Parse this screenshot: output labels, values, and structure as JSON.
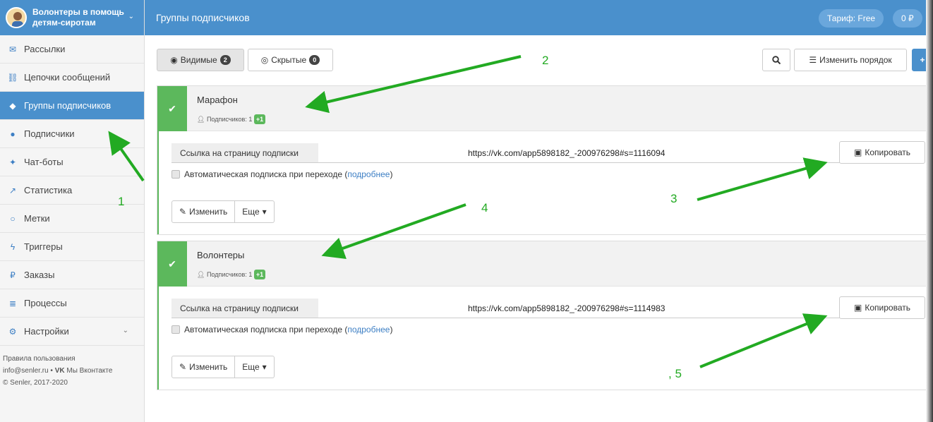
{
  "brand": {
    "name": "Волонтеры в помощь детям-сиротам"
  },
  "sidebar": {
    "items": [
      {
        "label": "Рассылки",
        "icon": "envelope-icon"
      },
      {
        "label": "Цепочки сообщений",
        "icon": "chain-icon"
      },
      {
        "label": "Группы подписчиков",
        "icon": "tags-icon",
        "active": true
      },
      {
        "label": "Подписчики",
        "icon": "users-icon"
      },
      {
        "label": "Чат-боты",
        "icon": "android-icon"
      },
      {
        "label": "Статистика",
        "icon": "chart-line-icon"
      },
      {
        "label": "Метки",
        "icon": "circle-icon"
      },
      {
        "label": "Триггеры",
        "icon": "bolt-icon"
      },
      {
        "label": "Заказы",
        "icon": "ruble-icon"
      },
      {
        "label": "Процессы",
        "icon": "list-icon"
      },
      {
        "label": "Настройки",
        "icon": "cogs-icon"
      }
    ],
    "footer": {
      "terms": "Правила пользования",
      "contact": "info@senler.ru • ",
      "vk": "Мы Вконтакте",
      "copyright": "© Senler, 2017-2020"
    }
  },
  "header": {
    "title": "Группы подписчиков",
    "tariff": "Тариф: Free",
    "balance": "0 ₽"
  },
  "toolbar": {
    "visible_label": "Видимые",
    "visible_count": "2",
    "hidden_label": "Скрытые",
    "hidden_count": "0",
    "reorder_label": "Изменить порядок"
  },
  "groups": [
    {
      "name": "Марафон",
      "subscribers_label": "Подписчиков: 1",
      "subscribers_delta": "+1",
      "link_label": "Ссылка на страницу подписки",
      "url": "https://vk.com/app5898182_-200976298#s=1116094",
      "copy_label": "Копировать",
      "auto_text": "Автоматическая подписка при переходе (",
      "auto_link": "подробнее",
      "auto_close": ")",
      "edit_label": "Изменить",
      "more_label": "Еще"
    },
    {
      "name": "Волонтеры",
      "subscribers_label": "Подписчиков: 1",
      "subscribers_delta": "+1",
      "link_label": "Ссылка на страницу подписки",
      "url": "https://vk.com/app5898182_-200976298#s=1114983",
      "copy_label": "Копировать",
      "auto_text": "Автоматическая подписка при переходе (",
      "auto_link": "подробнее",
      "auto_close": ")",
      "edit_label": "Изменить",
      "more_label": "Еще"
    }
  ],
  "annotations": {
    "n1": "1",
    "n2": "2",
    "n3": "3",
    "n4": "4",
    "n5": ", 5"
  },
  "colors": {
    "accent": "#4a90cc",
    "success": "#5cb85c",
    "annotation": "#22aa22"
  }
}
